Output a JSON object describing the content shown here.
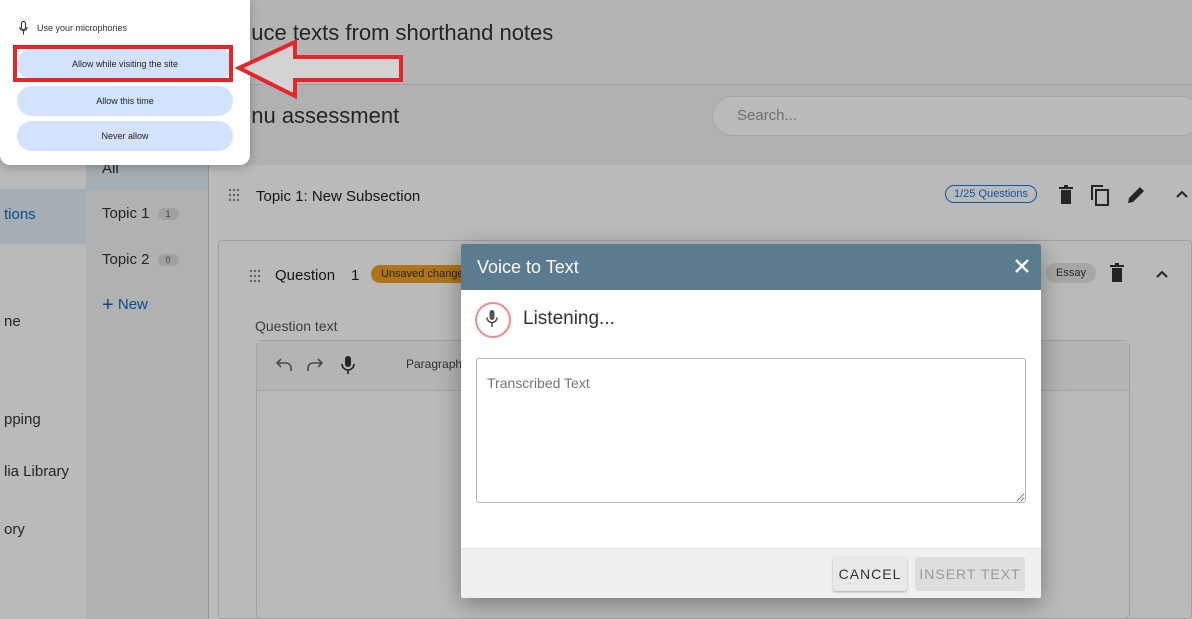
{
  "left_nav": {
    "items": [
      "tions",
      "ne",
      "pping",
      "lia Library",
      "ory"
    ]
  },
  "topics": {
    "all_label": "All",
    "items": [
      {
        "label": "Topic 1",
        "count": "1"
      },
      {
        "label": "Topic 2",
        "count": "0"
      }
    ],
    "new_label": "New"
  },
  "page": {
    "title": "duce texts from shorthand notes",
    "subtitle": "enu assessment",
    "search_placeholder": "Search..."
  },
  "topic_header": {
    "title": "Topic 1: New Subsection",
    "questions_badge": "1/25 Questions"
  },
  "question_card": {
    "label": "Question",
    "number": "1",
    "unsaved_badge": "Unsaved changes",
    "type_badge": "Essay",
    "question_text_label": "Question text",
    "paragraph_label": "Paragraph"
  },
  "dialog": {
    "title": "Voice to Text",
    "status": "Listening...",
    "transcript_placeholder": "Transcribed Text",
    "cancel_label": "CANCEL",
    "insert_label": "INSERT TEXT",
    "header_color": "#5b7c8e"
  },
  "permission_popup": {
    "label": "Use your microphones",
    "buttons": [
      "Allow while visiting the site",
      "Allow this time",
      "Never allow"
    ],
    "button_color": "#d3e3fd",
    "highlight_color": "#e3262a"
  }
}
